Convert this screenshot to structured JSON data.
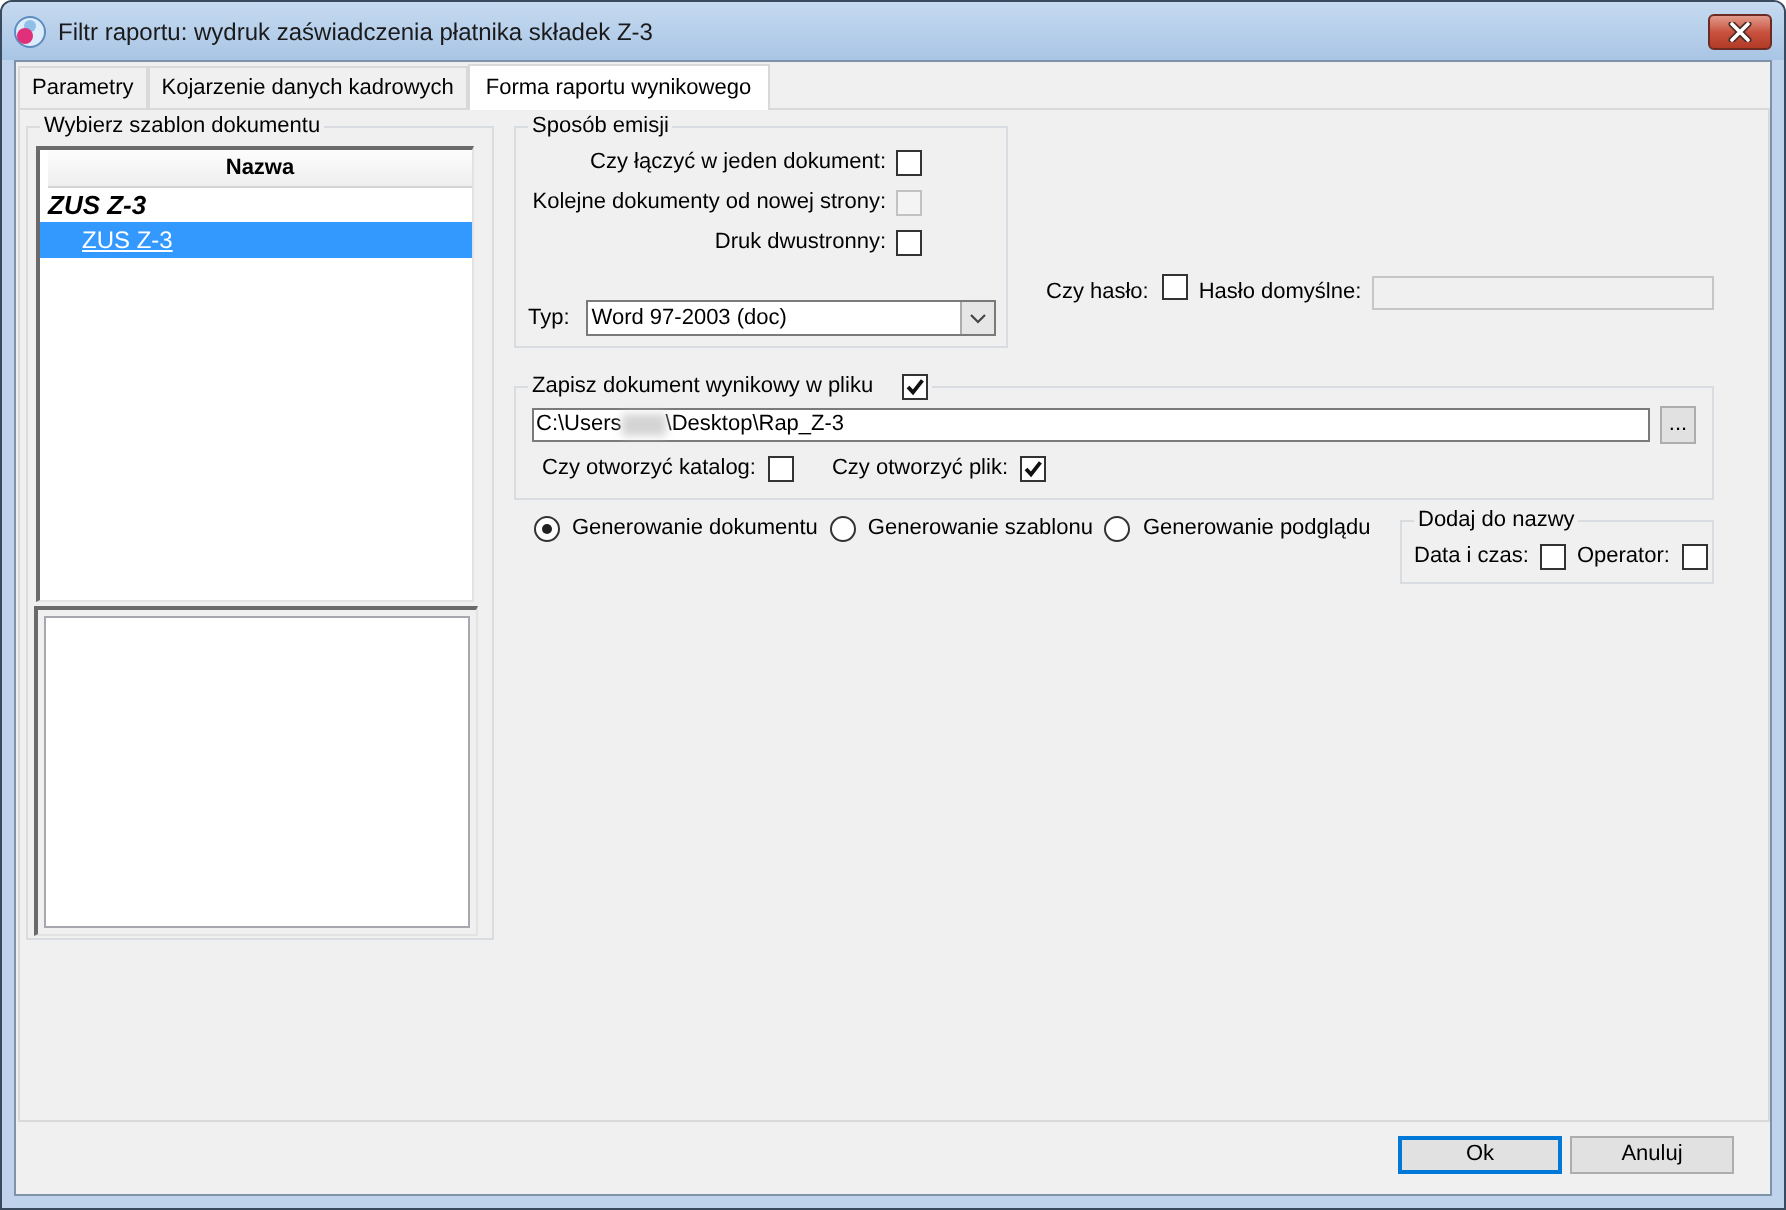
{
  "window": {
    "title": "Filtr raportu: wydruk zaświadczenia płatnika składek Z-3"
  },
  "tabs": [
    {
      "label": "Parametry",
      "selected": false
    },
    {
      "label": "Kojarzenie danych kadrowych",
      "selected": false
    },
    {
      "label": "Forma raportu wynikowego",
      "selected": true
    }
  ],
  "template_group": {
    "title": "Wybierz szablon dokumentu",
    "column": "Nazwa",
    "rows": [
      {
        "kind": "group",
        "label": "ZUS Z-3",
        "selected": false
      },
      {
        "kind": "item",
        "label": "ZUS Z-3",
        "selected": true
      }
    ]
  },
  "emission_group": {
    "title": "Sposób emisji",
    "options": [
      {
        "label": "Czy łączyć w jeden dokument:",
        "checked": false,
        "disabled": false
      },
      {
        "label": "Kolejne dokumenty od nowej strony:",
        "checked": false,
        "disabled": true
      },
      {
        "label": "Druk dwustronny:",
        "checked": false,
        "disabled": false
      }
    ],
    "type_label": "Typ:",
    "type_value": "Word 97-2003 (doc)"
  },
  "password": {
    "label": "Czy hasło:",
    "checked": false,
    "default_label": "Hasło domyślne:",
    "default_disabled": true
  },
  "save_group": {
    "label": "Zapisz dokument wynikowy w pliku",
    "checked": true,
    "path_start": "C:\\Users",
    "path_end": "\\Desktop\\Rap_Z-3",
    "browse_label": "...",
    "options": [
      {
        "label": "Czy otworzyć katalog:",
        "checked": false
      },
      {
        "label": "Czy otworzyć plik:",
        "checked": true
      }
    ]
  },
  "generation_modes": [
    {
      "label": "Generowanie dokumentu",
      "selected": true
    },
    {
      "label": "Generowanie szablonu",
      "selected": false
    },
    {
      "label": "Generowanie podglądu",
      "selected": false
    }
  ],
  "name_group": {
    "title": "Dodaj do nazwy",
    "options": [
      {
        "label": "Data i czas:",
        "checked": false
      },
      {
        "label": "Operator:",
        "checked": false
      }
    ]
  },
  "buttons": [
    {
      "label": "Ok",
      "kind": "default"
    },
    {
      "label": "Anuluj",
      "kind": "normal"
    }
  ]
}
